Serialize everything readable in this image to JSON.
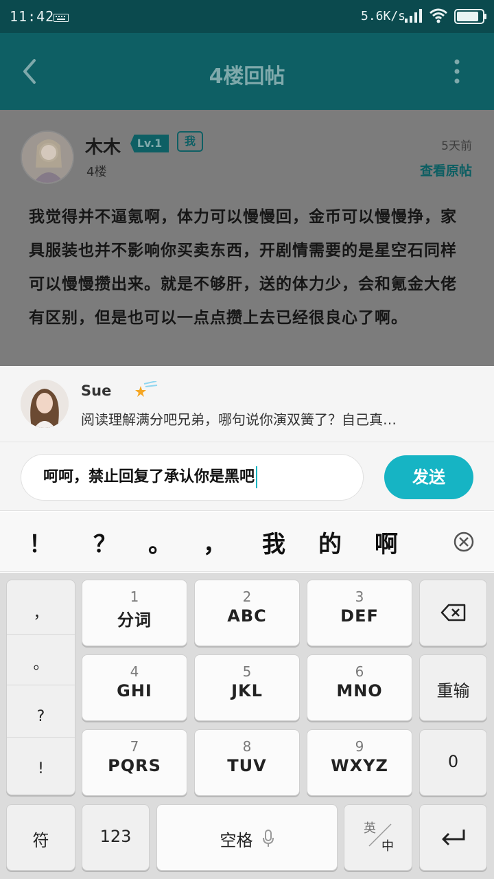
{
  "status_bar": {
    "time": "11:42",
    "speed": "5.6K/s"
  },
  "app_bar": {
    "title": "4楼回帖"
  },
  "post": {
    "author": "木木",
    "level": "Lv.1",
    "me_badge": "我",
    "floor": "4楼",
    "time": "5天前",
    "view_original": "查看原帖",
    "body": "我觉得并不逼氪啊，体力可以慢慢回，金币可以慢慢挣，家具服装也并不影响你买卖东西，开剧情需要的是星空石同样可以慢慢攒出来。就是不够肝，送的体力少，会和氪金大佬有区别，但是也可以一点点攒上去已经很良心了啊。"
  },
  "quote": {
    "name": "Sue",
    "text": "阅读理解满分吧兄弟，哪句说你演双簧了？自己真…"
  },
  "reply": {
    "input_value": "呵呵，禁止回复了承认你是黑吧",
    "send_label": "发送"
  },
  "candidates": [
    "！",
    "？",
    "。",
    "，",
    "我",
    "的",
    "啊"
  ],
  "keyboard": {
    "symbols": [
      "，",
      "。",
      "?",
      "!"
    ],
    "keys": [
      {
        "digit": "1",
        "letters": "分词"
      },
      {
        "digit": "2",
        "letters": "ABC"
      },
      {
        "digit": "3",
        "letters": "DEF"
      },
      {
        "digit": "4",
        "letters": "GHI"
      },
      {
        "digit": "5",
        "letters": "JKL"
      },
      {
        "digit": "6",
        "letters": "MNO"
      },
      {
        "digit": "7",
        "letters": "PQRS"
      },
      {
        "digit": "8",
        "letters": "TUV"
      },
      {
        "digit": "9",
        "letters": "WXYZ"
      }
    ],
    "reenter": "重输",
    "zero": "0",
    "fu": "符",
    "num": "123",
    "space": "空格",
    "lang_en": "英",
    "lang_zh": "中"
  }
}
